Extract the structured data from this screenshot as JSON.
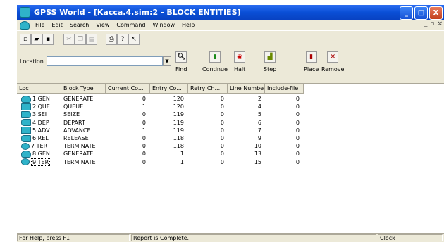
{
  "window": {
    "title": "GPSS World - [Kacca.4.sim:2  - BLOCK ENTITIES]",
    "controls": {
      "minimize": "_",
      "maximize": "□",
      "close": "X"
    }
  },
  "menu": {
    "items": [
      "File",
      "Edit",
      "Search",
      "View",
      "Command",
      "Window",
      "Help"
    ],
    "mdi_controls": [
      "_",
      "▫",
      "×"
    ]
  },
  "panel": {
    "location_label": "Location",
    "location_value": "",
    "buttons": [
      {
        "label": "Find",
        "icon": "magnifier-icon"
      },
      {
        "label": "Continue",
        "icon": "traffic-light-green-icon"
      },
      {
        "label": "Halt",
        "icon": "halt-icon"
      },
      {
        "label": "Step",
        "icon": "step-icon"
      },
      {
        "label": "Place",
        "icon": "place-icon"
      },
      {
        "label": "Remove",
        "icon": "remove-icon"
      }
    ]
  },
  "table": {
    "headers": [
      "Loc",
      "Block Type",
      "Current Co...",
      "Entry Co...",
      "Retry Ch...",
      "Line Number",
      "Include-file"
    ],
    "rows": [
      {
        "loc": "1 GEN",
        "type": "GENERATE",
        "current": "0",
        "entry": "120",
        "retry": "0",
        "line": "2",
        "include": "0",
        "icon": "gen"
      },
      {
        "loc": "2 QUE",
        "type": "QUEUE",
        "current": "1",
        "entry": "120",
        "retry": "0",
        "line": "4",
        "include": "0",
        "icon": "queue"
      },
      {
        "loc": "3 SEI",
        "type": "SEIZE",
        "current": "0",
        "entry": "119",
        "retry": "0",
        "line": "5",
        "include": "0",
        "icon": "seize"
      },
      {
        "loc": "4 DEP",
        "type": "DEPART",
        "current": "0",
        "entry": "119",
        "retry": "0",
        "line": "6",
        "include": "0",
        "icon": "depart"
      },
      {
        "loc": "5 ADV",
        "type": "ADVANCE",
        "current": "1",
        "entry": "119",
        "retry": "0",
        "line": "7",
        "include": "0",
        "icon": "advance"
      },
      {
        "loc": "6 REL",
        "type": "RELEASE",
        "current": "0",
        "entry": "118",
        "retry": "0",
        "line": "9",
        "include": "0",
        "icon": "release"
      },
      {
        "loc": "7 TER",
        "type": "TERMINATE",
        "current": "0",
        "entry": "118",
        "retry": "0",
        "line": "10",
        "include": "0",
        "icon": "term"
      },
      {
        "loc": "8 GEN",
        "type": "GENERATE",
        "current": "0",
        "entry": "1",
        "retry": "0",
        "line": "13",
        "include": "0",
        "icon": "gen"
      },
      {
        "loc": "9 TER",
        "type": "TERMINATE",
        "current": "0",
        "entry": "1",
        "retry": "0",
        "line": "15",
        "include": "0",
        "icon": "term"
      }
    ]
  },
  "status": {
    "help": "For Help, press F1",
    "message": "Report is Complete.",
    "clock": "Clock"
  }
}
